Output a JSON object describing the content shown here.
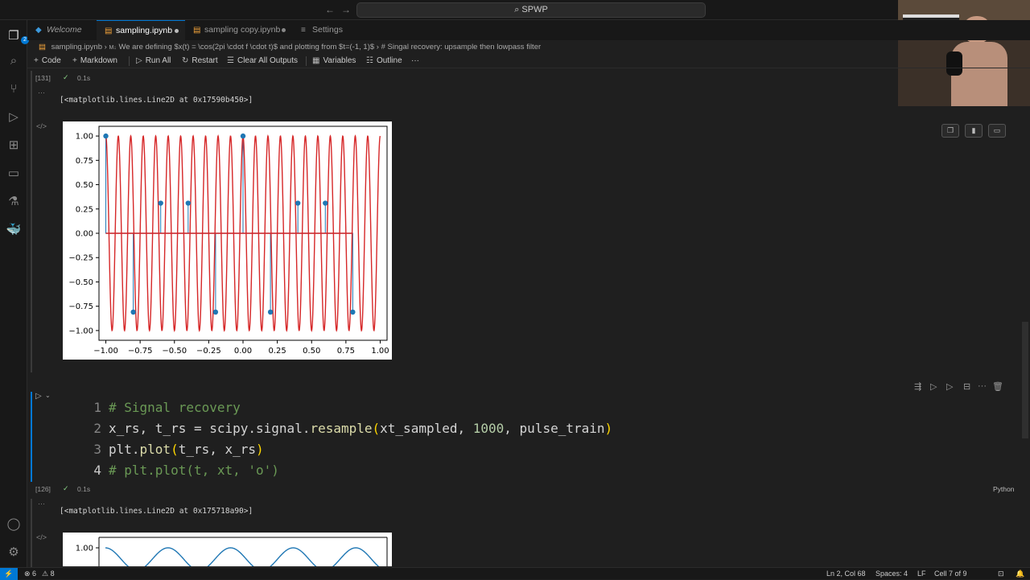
{
  "titlebar": {
    "search": "SPWP",
    "back": "←",
    "forward": "→"
  },
  "activity_bar": {
    "explorer_badge": "2"
  },
  "tabs": [
    {
      "label": "Welcome"
    },
    {
      "label": "sampling.ipynb"
    },
    {
      "label": "sampling copy.ipynb"
    },
    {
      "label": "Settings"
    }
  ],
  "breadcrumb": {
    "file": "sampling.ipynb",
    "md_tag": "M↓",
    "item1": "We are defining $x(t) = \\cos(2pi \\cdot f \\cdot t)$ and plotting from $t=(-1, 1)$",
    "item2": "# Singal recovery: upsample then lowpass filter"
  },
  "toolbar": {
    "code": "Code",
    "markdown": "Markdown",
    "run_all": "Run All",
    "restart": "Restart",
    "clear": "Clear All Outputs",
    "variables": "Variables",
    "outline": "Outline",
    "more": "···"
  },
  "cells": {
    "top_exec_count": "[131]",
    "top_time": "0.1s",
    "output1_text": "[<matplotlib.lines.Line2D at 0x17590b450>]",
    "code_exec_count": "[126]",
    "code_time": "0.1s",
    "language": "Python",
    "output2_text": "[<matplotlib.lines.Line2D at 0x175718a90>]",
    "code_lines": [
      {
        "n": "1",
        "text": "# Signal recovery"
      },
      {
        "n": "2",
        "text": "x_rs, t_rs = scipy.signal.resample(xt_sampled, 1000, pulse_train)"
      },
      {
        "n": "3",
        "text": "plt.plot(t_rs, x_rs)"
      },
      {
        "n": "4",
        "text": "# plt.plot(t, xt, 'o')"
      }
    ]
  },
  "chart_data": [
    {
      "type": "line",
      "xlim": [
        -1.05,
        1.05
      ],
      "ylim": [
        -1.1,
        1.1
      ],
      "xticks": [
        "−1.00",
        "−0.75",
        "−0.50",
        "−0.25",
        "0.00",
        "0.25",
        "0.50",
        "0.75",
        "1.00"
      ],
      "yticks": [
        "1.00",
        "0.75",
        "0.50",
        "0.25",
        "0.00",
        "−0.25",
        "−0.50",
        "−0.75",
        "−1.00"
      ],
      "series": [
        {
          "style": "red cosine line",
          "frequency": 11,
          "color": "#d62728"
        },
        {
          "style": "blue stem pulse train",
          "color": "#1f77b4",
          "x": [
            -1.0,
            -0.8,
            -0.6,
            -0.4,
            -0.2,
            0.0,
            0.2,
            0.4,
            0.6,
            0.8
          ],
          "y": [
            1.0,
            -0.81,
            0.31,
            0.31,
            -0.81,
            1.0,
            -0.81,
            0.31,
            0.31,
            -0.81
          ]
        }
      ]
    },
    {
      "type": "line",
      "yticks": [
        "1.00"
      ],
      "series": [
        {
          "style": "blue resampled line",
          "color": "#1f77b4"
        }
      ]
    }
  ],
  "statusbar": {
    "errors": "⊗ 6",
    "warnings": "⚠ 8",
    "position": "Ln 2, Col 68",
    "spaces": "Spaces: 4",
    "eol": "LF",
    "cell": "Cell 7 of 9"
  }
}
